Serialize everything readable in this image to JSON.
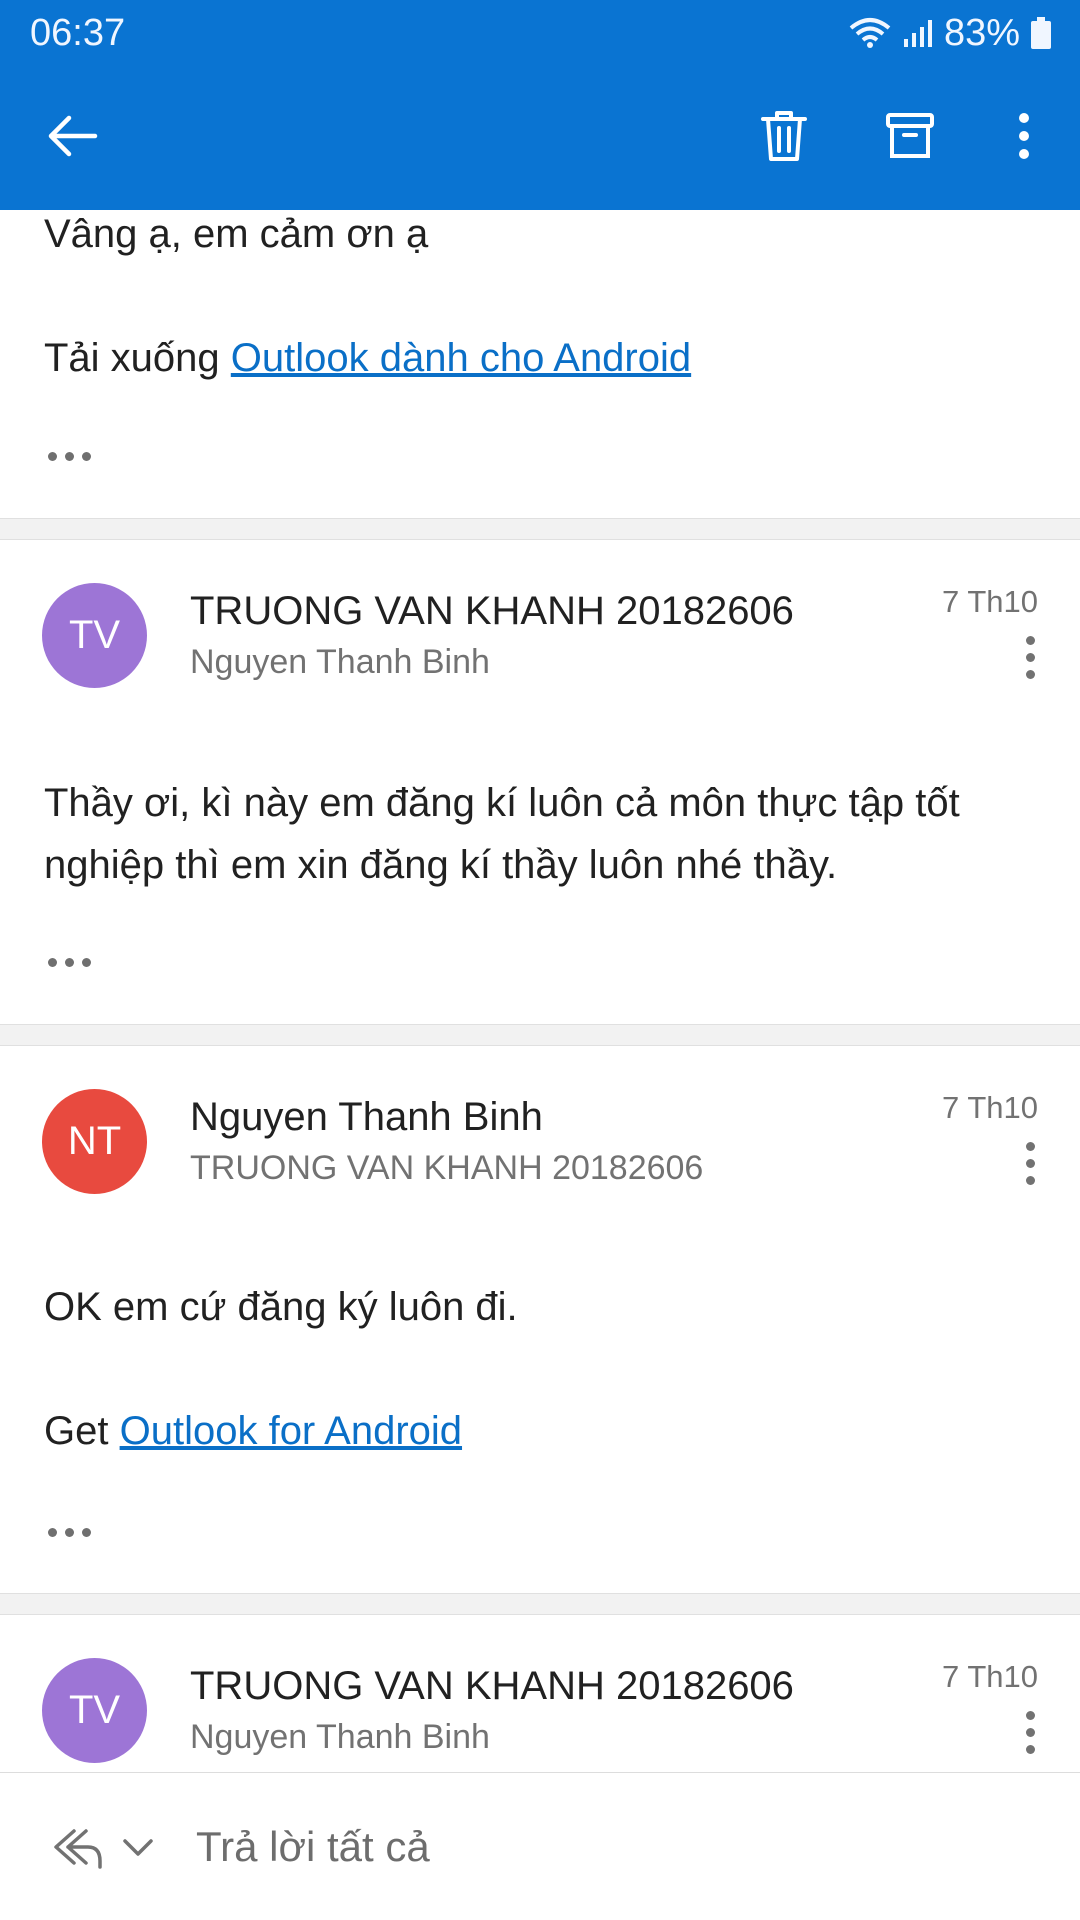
{
  "status_bar": {
    "time": "06:37",
    "battery": "83%"
  },
  "toolbar": {
    "back_icon": "back-arrow-icon",
    "delete_icon": "trash-icon",
    "archive_icon": "archive-icon",
    "more_icon": "more-vertical-icon"
  },
  "messages": [
    {
      "body_lines": [
        "Vâng ạ, em cảm ơn ạ"
      ],
      "signature_prefix": "Tải xuống",
      "signature_link": "Outlook dành cho Android"
    },
    {
      "initials": "TV",
      "avatar_color": "#9d75d6",
      "sender": "TRUONG VAN KHANH 20182606",
      "recipient": "Nguyen Thanh Binh",
      "date": "7 Th10",
      "body_lines": [
        "Thầy ơi, kì này em đăng kí luôn cả môn thực tập tốt",
        "nghiệp thì em xin đăng kí thầy luôn nhé thầy."
      ]
    },
    {
      "initials": "NT",
      "avatar_color": "#e84a3f",
      "sender": "Nguyen Thanh Binh",
      "recipient": "TRUONG VAN KHANH 20182606",
      "date": "7 Th10",
      "body_lines": [
        "OK em cứ đăng ký luôn đi."
      ],
      "signature_prefix": "Get",
      "signature_link": "Outlook for Android"
    },
    {
      "initials": "TV",
      "avatar_color": "#9d75d6",
      "sender": "TRUONG VAN KHANH 20182606",
      "recipient": "Nguyen Thanh Binh",
      "date": "7 Th10"
    }
  ],
  "bottom_bar": {
    "reply_all_label": "Trả lời tất cả",
    "reply_icon": "reply-all-icon",
    "dropdown_icon": "chevron-down-icon"
  },
  "colors": {
    "accent": "#0a74d2",
    "link": "#0a6fc7"
  }
}
